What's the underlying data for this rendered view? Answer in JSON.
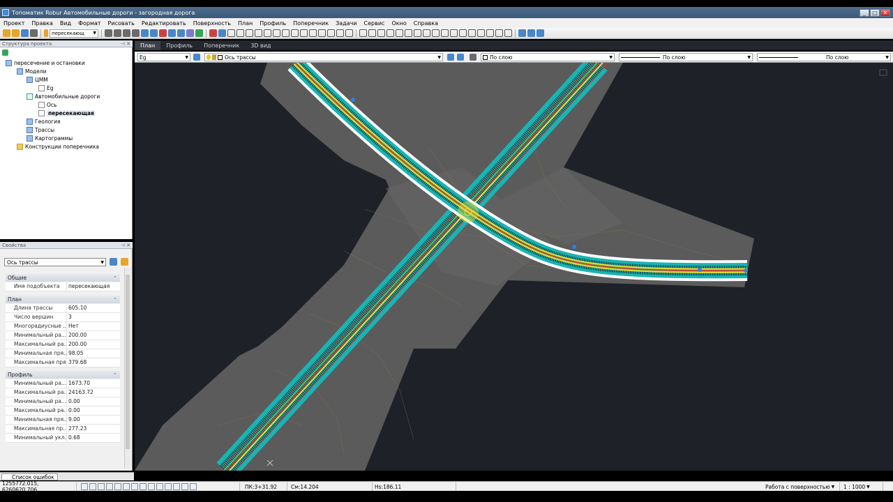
{
  "window": {
    "title": "Топоматик Robur Автомобильные дороги - загородная дорога",
    "buttons": [
      "_",
      "□",
      "✕"
    ]
  },
  "menu": [
    "Проект",
    "Правка",
    "Вид",
    "Формат",
    "Рисовать",
    "Редактировать",
    "Поверхность",
    "План",
    "Профиль",
    "Поперечник",
    "Задачи",
    "Сервис",
    "Окно",
    "Справка"
  ],
  "toolbar": {
    "object_combo": "пересекающ",
    "icons": [
      "new-icon",
      "open-icon",
      "save-icon",
      "print-icon",
      "cut-icon",
      "copy-icon",
      "paste-icon",
      "undo-icon",
      "redo-icon",
      "zoom-icon",
      "pan-icon",
      "layers-icon",
      "refresh-icon"
    ]
  },
  "tree_panel": {
    "title": "Структура проекта",
    "items": {
      "root": "пересечение и остановки",
      "models": "Модели",
      "dtm": "ЦММ",
      "eg": "Eg",
      "roads": "Автомобильные дороги",
      "axis": "Ось",
      "crossing": "пересекающая",
      "geology": "Геология",
      "routes": "Трассы",
      "cartograms": "Картограммы",
      "cross_sections": "Конструкции поперечника"
    }
  },
  "props_panel": {
    "title": "Свойства",
    "combo": "Ось трассы",
    "general": {
      "title": "Общие",
      "rows": [
        [
          "Имя подобъекта",
          "пересекающая"
        ]
      ]
    },
    "plan": {
      "title": "План",
      "rows": [
        [
          "Длина трассы",
          "605.10"
        ],
        [
          "Число вершин",
          "3"
        ],
        [
          "Многорадиусные ...",
          "Нет"
        ],
        [
          "Минимальный ра...",
          "200.00"
        ],
        [
          "Максимальный ра...",
          "200.00"
        ],
        [
          "Минимальная пря...",
          "98.05"
        ],
        [
          "Максимальная пря...",
          "379.68"
        ]
      ]
    },
    "profile": {
      "title": "Профиль",
      "rows": [
        [
          "Минимальный ра...",
          "1673.70"
        ],
        [
          "Максимальный ра...",
          "24163.72"
        ],
        [
          "Минимальный ра...",
          "0.00"
        ],
        [
          "Максимальный ра...",
          "0.00"
        ],
        [
          "Минимальная пря...",
          "9.00"
        ],
        [
          "Максимальная пр...",
          "277.23"
        ],
        [
          "Минимальный укл...",
          "0.68"
        ]
      ]
    }
  },
  "bottom_tab": "Список ошибок",
  "view_tabs": [
    "План",
    "Профиль",
    "Поперечник",
    "3D вид"
  ],
  "layer_bar": {
    "surface": "Eg",
    "layer": "Ось трассы",
    "color": "По слою",
    "linetype": "По слою",
    "lineweight": "По слою"
  },
  "status": {
    "coords": "1255772.015, 6260620.706",
    "pk": "ПК:3+31.92",
    "offset": "См:14.204",
    "height": "Нs:186.11",
    "mode": "Работа с поверхностью",
    "scale": "1 : 1000"
  },
  "colors": {
    "canvas": "#1e2127",
    "surface": "#5b5b5b",
    "cyan": "#19b4b4",
    "road_red": "#d03030",
    "road_yellow": "#e6e23a",
    "road_green": "#76c24a"
  }
}
